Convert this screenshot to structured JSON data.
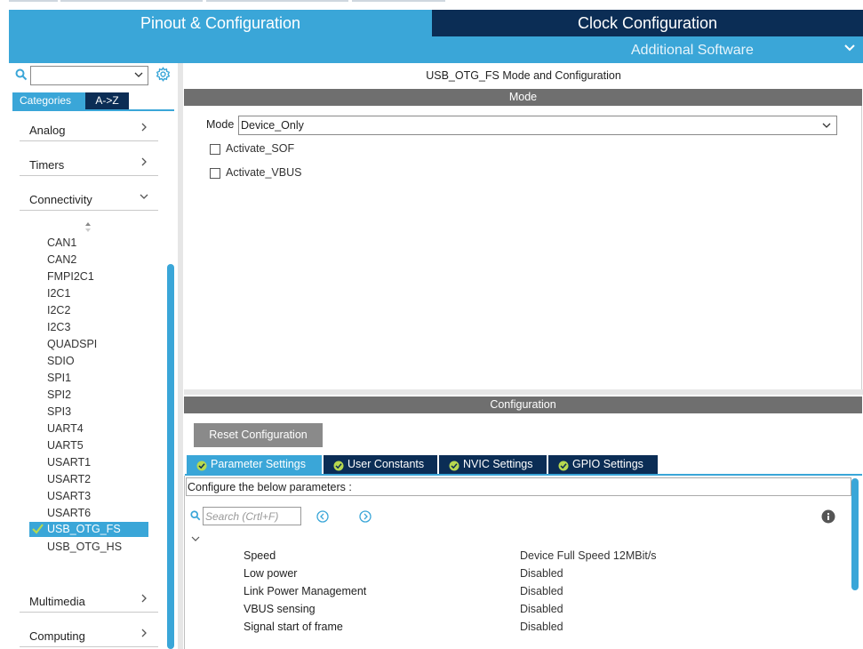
{
  "tabs": {
    "pinout_label": "Pinout & Configuration",
    "clock_label": "Clock Configuration",
    "additional_label": "Additional Software"
  },
  "colors": {
    "accent": "#3aa6d8",
    "dark": "#0b2d55",
    "header_gray": "#6f6f6f",
    "check_green": "#b7d94f"
  },
  "sidebar": {
    "search_value": "",
    "categories_tab": "Categories",
    "az_tab": "A->Z",
    "categories": [
      {
        "label": "Analog",
        "expanded": false
      },
      {
        "label": "Timers",
        "expanded": false
      },
      {
        "label": "Connectivity",
        "expanded": true
      },
      {
        "label": "Multimedia",
        "expanded": false
      },
      {
        "label": "Computing",
        "expanded": false
      }
    ],
    "peripherals": [
      "CAN1",
      "CAN2",
      "FMPI2C1",
      "I2C1",
      "I2C2",
      "I2C3",
      "QUADSPI",
      "SDIO",
      "SPI1",
      "SPI2",
      "SPI3",
      "UART4",
      "UART5",
      "USART1",
      "USART2",
      "USART3",
      "USART6",
      "USB_OTG_FS",
      "USB_OTG_HS"
    ],
    "selected": "USB_OTG_FS"
  },
  "panel": {
    "title": "USB_OTG_FS Mode and Configuration",
    "mode_header": "Mode",
    "mode_label": "Mode",
    "mode_value": "Device_Only",
    "checkboxes": [
      {
        "label": "Activate_SOF",
        "checked": false
      },
      {
        "label": "Activate_VBUS",
        "checked": false
      }
    ],
    "config_header": "Configuration",
    "reset_label": "Reset Configuration",
    "config_tabs": [
      "Parameter Settings",
      "User Constants",
      "NVIC Settings",
      "GPIO Settings"
    ],
    "active_tab": "Parameter Settings",
    "configure_text": "Configure the below parameters :",
    "search_placeholder": "Search (Crtl+F)",
    "parameters": [
      {
        "name": "Speed",
        "value": "Device Full Speed 12MBit/s"
      },
      {
        "name": "Low power",
        "value": "Disabled"
      },
      {
        "name": "Link Power Management",
        "value": "Disabled"
      },
      {
        "name": "VBUS sensing",
        "value": "Disabled"
      },
      {
        "name": "Signal start of frame",
        "value": "Disabled"
      }
    ]
  }
}
